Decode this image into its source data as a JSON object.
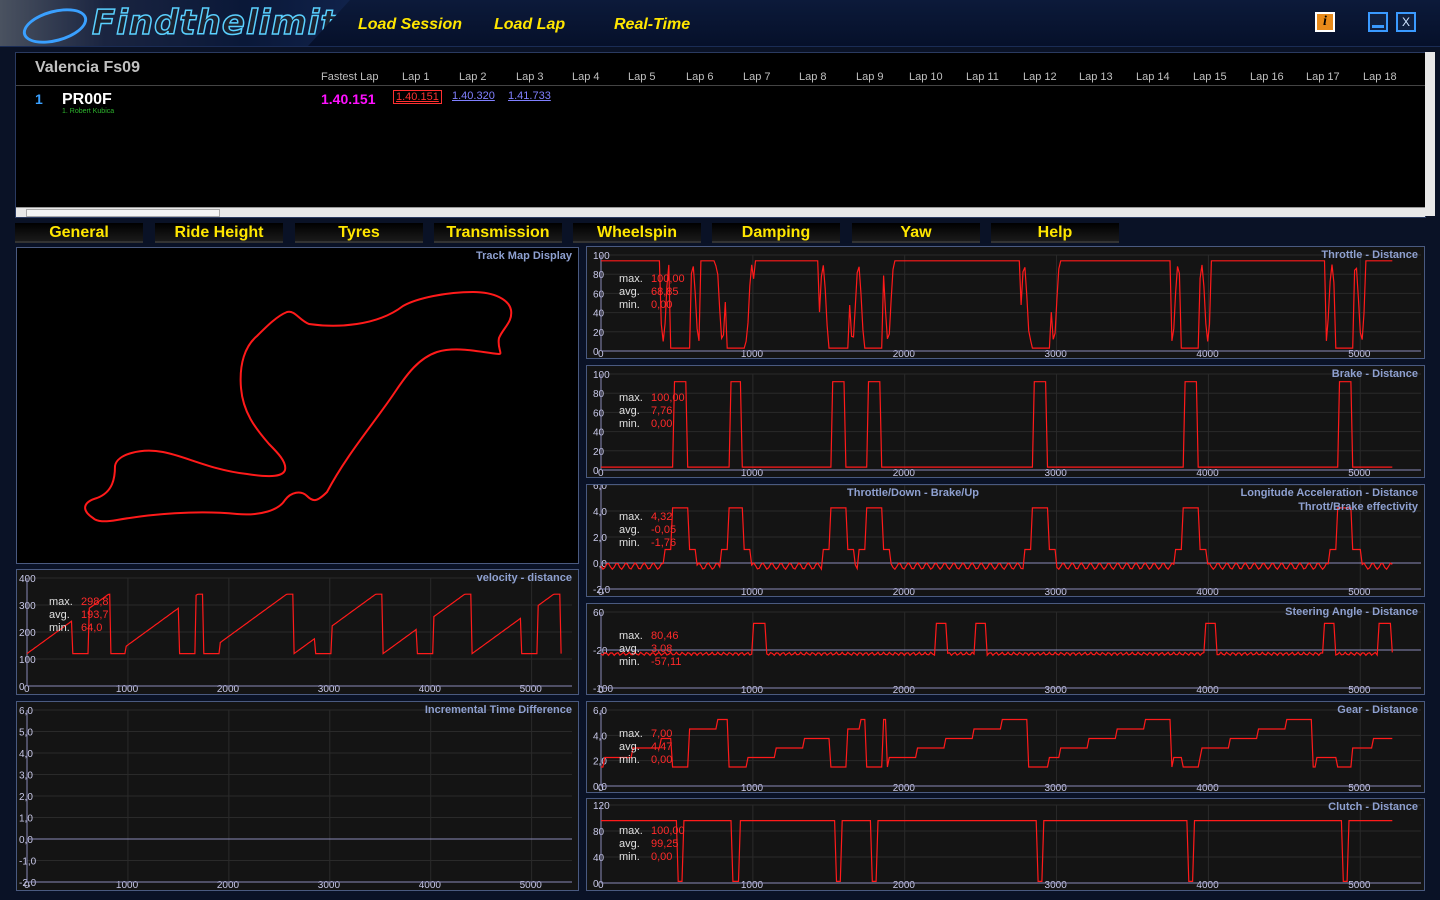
{
  "app": {
    "logo_text": "Findthelimit",
    "menu": {
      "load_session": "Load Session",
      "load_lap": "Load Lap",
      "real_time": "Real-Time"
    },
    "window_buttons": {
      "info": "i",
      "close": "X"
    }
  },
  "session": {
    "track": "Valencia Fs09",
    "headers": [
      "Fastest Lap",
      "Lap 1",
      "Lap 2",
      "Lap 3",
      "Lap 4",
      "Lap 5",
      "Lap 6",
      "Lap 7",
      "Lap 8",
      "Lap 9",
      "Lap 10",
      "Lap 11",
      "Lap 12",
      "Lap 13",
      "Lap 14",
      "Lap 15",
      "Lap 16",
      "Lap 17",
      "Lap 18"
    ],
    "row": {
      "pos": "1",
      "car": "PR00F",
      "driver": "1. Robert Kubica",
      "fastest": "1.40.151",
      "laps": [
        "1.40.151",
        "1.40.320",
        "1.41.733"
      ]
    }
  },
  "tabs": [
    "General",
    "Ride Height",
    "Tyres",
    "Transmission",
    "Wheelspin",
    "Damping",
    "Yaw",
    "Help"
  ],
  "colors": {
    "trace": "#ff1a1a",
    "accent": "#ffe600",
    "panel_title": "#8ea0d0",
    "fastest": "#ff10ff"
  },
  "track_map": {
    "title": "Track Map Display"
  },
  "velocity": {
    "title": "velocity - distance",
    "max": "298,8",
    "avg": "193,7",
    "min": "64,0",
    "x_ticks": [
      "0",
      "1000",
      "2000",
      "3000",
      "4000",
      "5000"
    ],
    "y_ticks": [
      "400",
      "300",
      "200",
      "100",
      "0"
    ]
  },
  "incremental": {
    "title": "Incremental Time Difference",
    "x_ticks": [
      "0",
      "1000",
      "2000",
      "3000",
      "4000",
      "5000"
    ],
    "y_ticks": [
      "6,0",
      "5,0",
      "4,0",
      "3,0",
      "2,0",
      "1,0",
      "0,0",
      "-1,0",
      "-2,0"
    ]
  },
  "throttle": {
    "title": "Throttle - Distance",
    "max": "100,00",
    "avg": "68,85",
    "min": "0,00",
    "x_ticks": [
      "0",
      "1000",
      "2000",
      "3000",
      "4000",
      "5000"
    ],
    "y_ticks": [
      "100",
      "80",
      "60",
      "40",
      "20",
      "0"
    ]
  },
  "brake": {
    "title": "Brake - Distance",
    "max": "100,00",
    "avg": "7,76",
    "min": "0,00",
    "x_ticks": [
      "0",
      "1000",
      "2000",
      "3000",
      "4000",
      "5000"
    ],
    "y_ticks": [
      "100",
      "80",
      "60",
      "40",
      "20",
      "0"
    ]
  },
  "longitude": {
    "title": "Longitude Acceleration - Distance",
    "subtitle": "Thrott/Brake effectivity",
    "center_title": "Throttle/Down - Brake/Up",
    "max": "4,32",
    "avg": "-0,05",
    "min": "-1,76",
    "x_ticks": [
      "0",
      "1000",
      "2000",
      "3000",
      "4000",
      "5000"
    ],
    "y_ticks": [
      "6,0",
      "4,0",
      "2,0",
      "0,0",
      "-2,0"
    ]
  },
  "steering": {
    "title": "Steering Angle - Distance",
    "max": "80,46",
    "avg": "3,08",
    "min": "-57,11",
    "x_ticks": [
      "0",
      "1000",
      "2000",
      "3000",
      "4000",
      "5000"
    ],
    "y_ticks": [
      "60",
      "-20",
      "-100"
    ]
  },
  "gear": {
    "title": "Gear - Distance",
    "max": "7,00",
    "avg": "4,47",
    "min": "0,00",
    "x_ticks": [
      "0",
      "1000",
      "2000",
      "3000",
      "4000",
      "5000"
    ],
    "y_ticks": [
      "6,0",
      "4,0",
      "2,0",
      "0,0"
    ]
  },
  "clutch": {
    "title": "Clutch - Distance",
    "max": "100,00",
    "avg": "99,25",
    "min": "0,00",
    "x_ticks": [
      "0",
      "1000",
      "2000",
      "3000",
      "4000",
      "5000"
    ],
    "y_ticks": [
      "120",
      "80",
      "40",
      "0"
    ]
  }
}
